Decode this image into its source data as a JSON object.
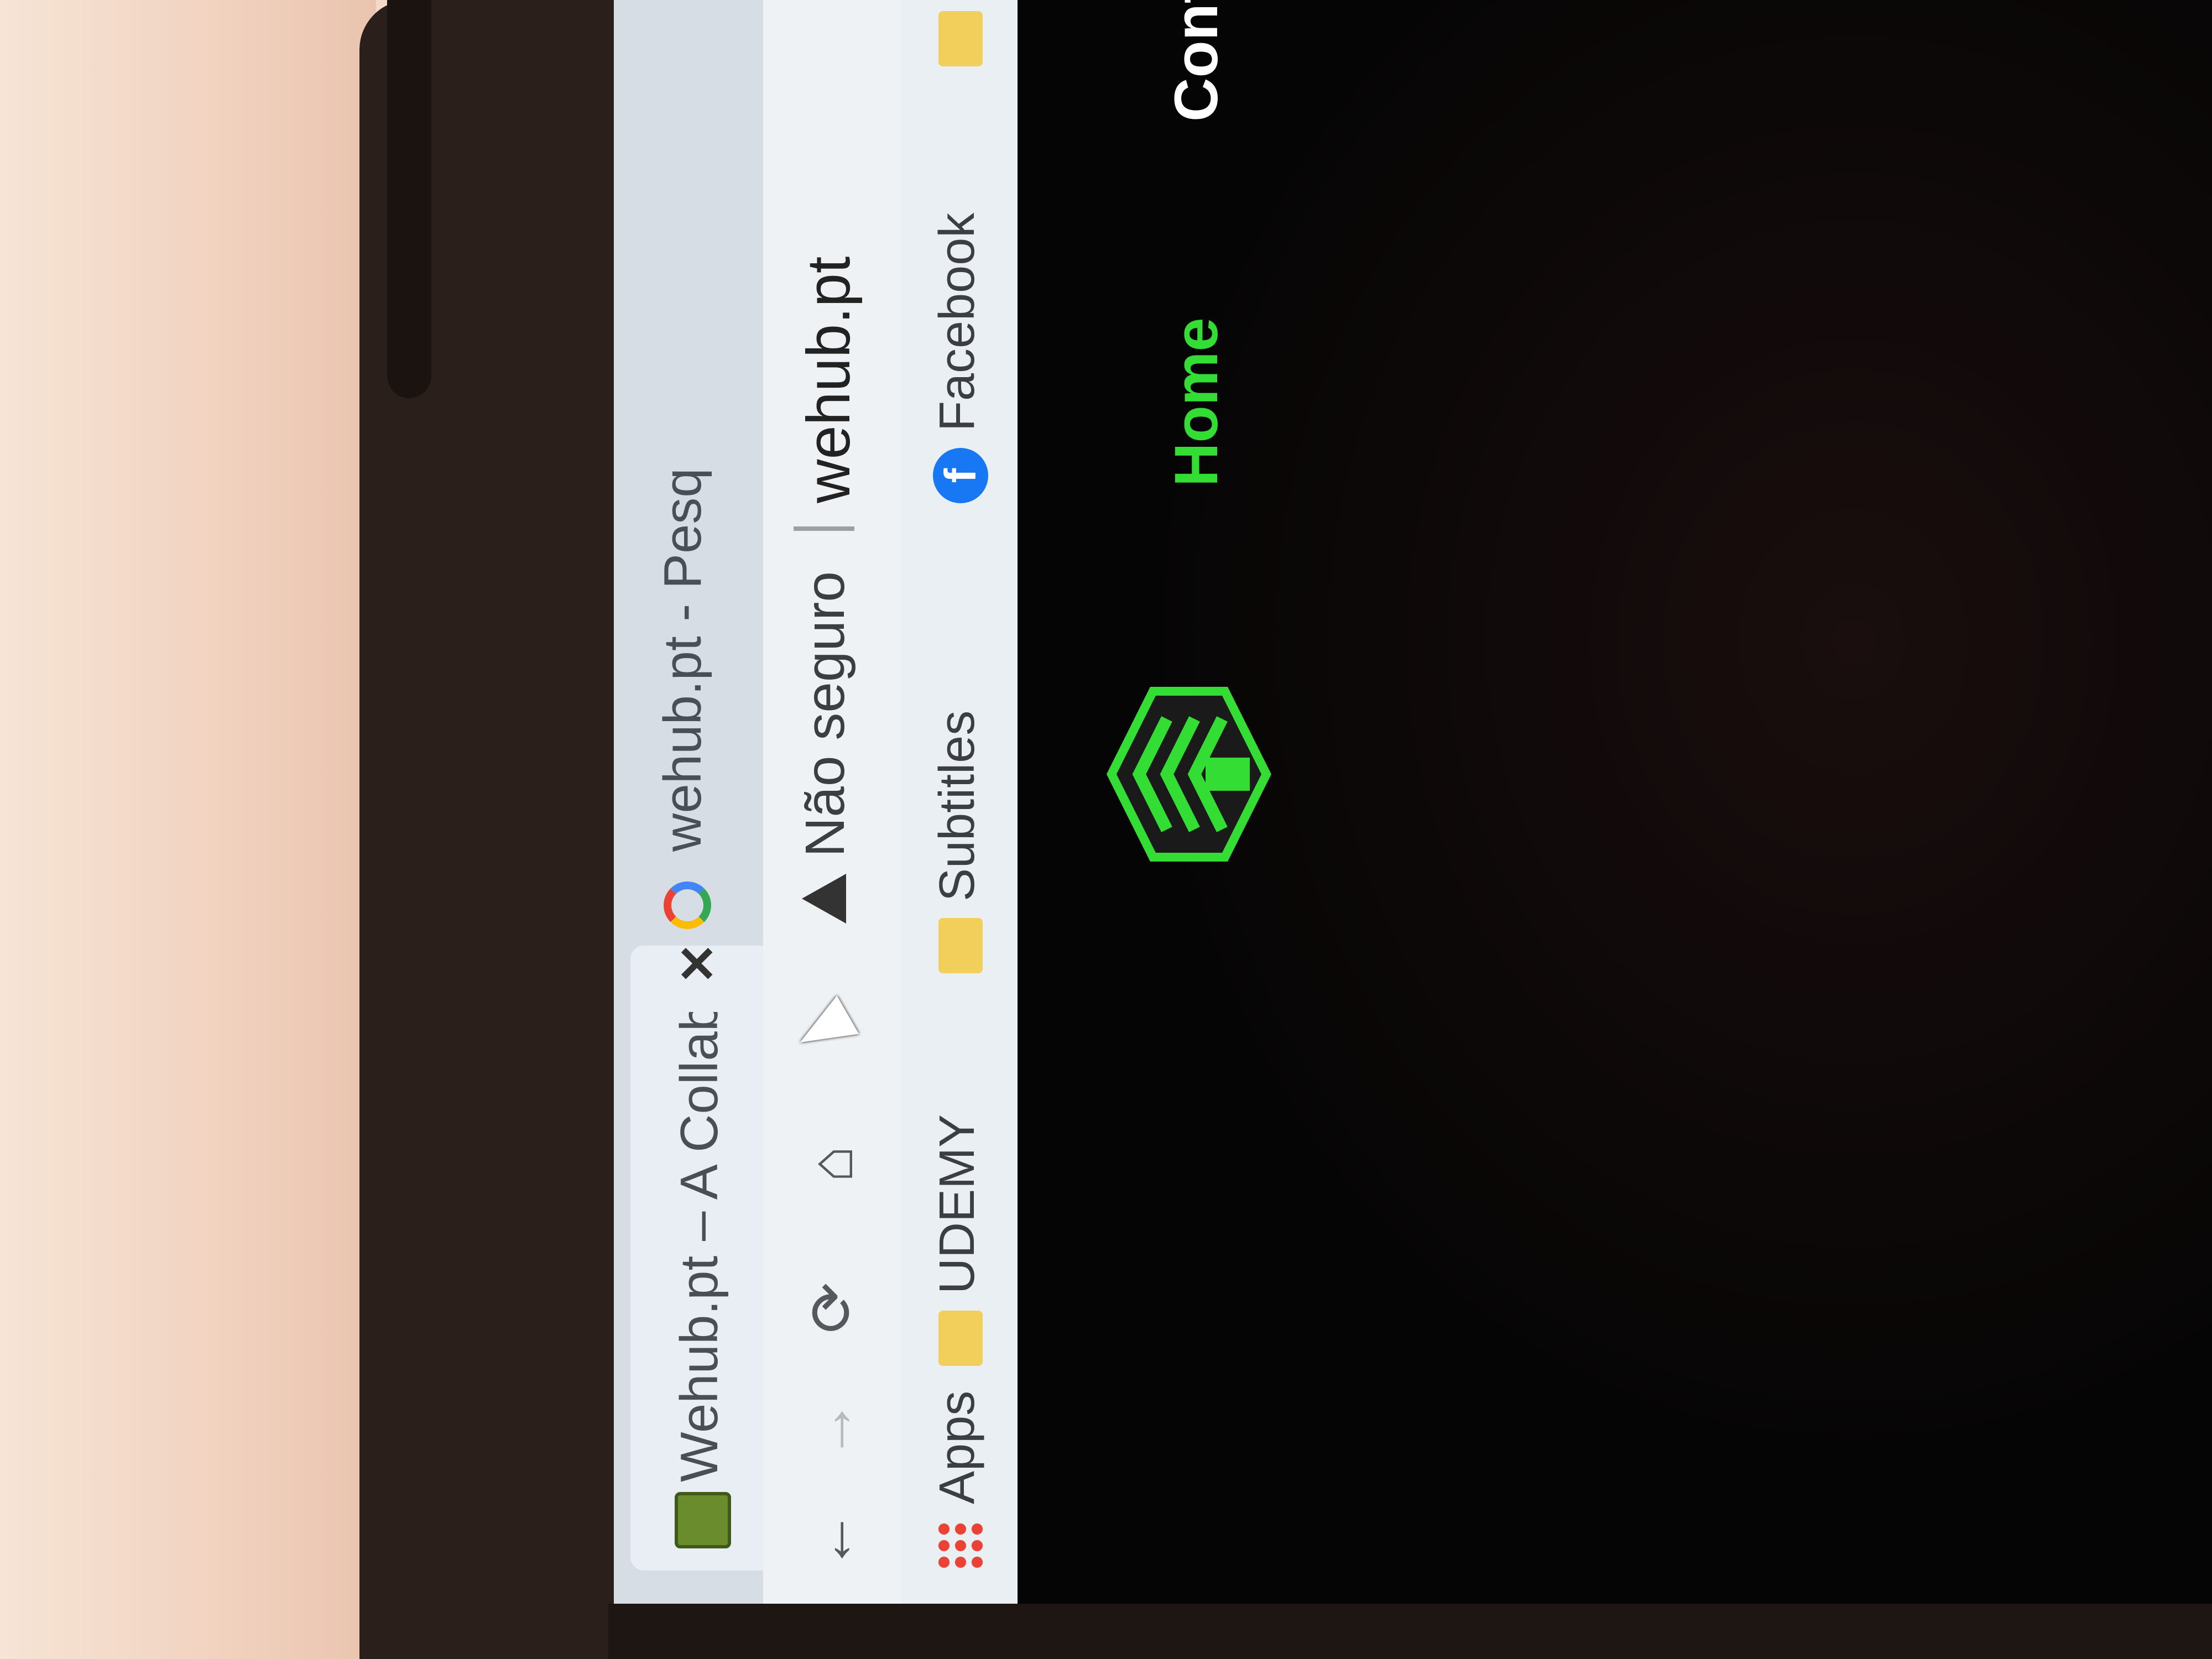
{
  "browser": {
    "tabs": [
      {
        "title": "Wehub.pt – A Collaborative ecos",
        "active": true
      },
      {
        "title": "wehub.pt - Pesq",
        "active": false
      }
    ],
    "tab_close_glyph": "✕",
    "toolbar": {
      "back": "←",
      "forward": "→",
      "reload": "⟳",
      "home": "⌂",
      "security_text": "Não seguro",
      "url": "wehub.pt"
    },
    "bookmarks": [
      {
        "icon": "apps-grid-icon",
        "label": "Apps"
      },
      {
        "icon": "folder-icon",
        "label": "UDEMY"
      },
      {
        "icon": "folder-icon",
        "label": "Subtitles"
      },
      {
        "icon": "facebook-icon",
        "label": "Facebook"
      },
      {
        "icon": "folder-icon",
        "label": ""
      }
    ]
  },
  "site": {
    "nav": {
      "home": "Home",
      "contact": "Contac"
    },
    "colors": {
      "accent": "#33dd33",
      "background": "#060505"
    }
  }
}
